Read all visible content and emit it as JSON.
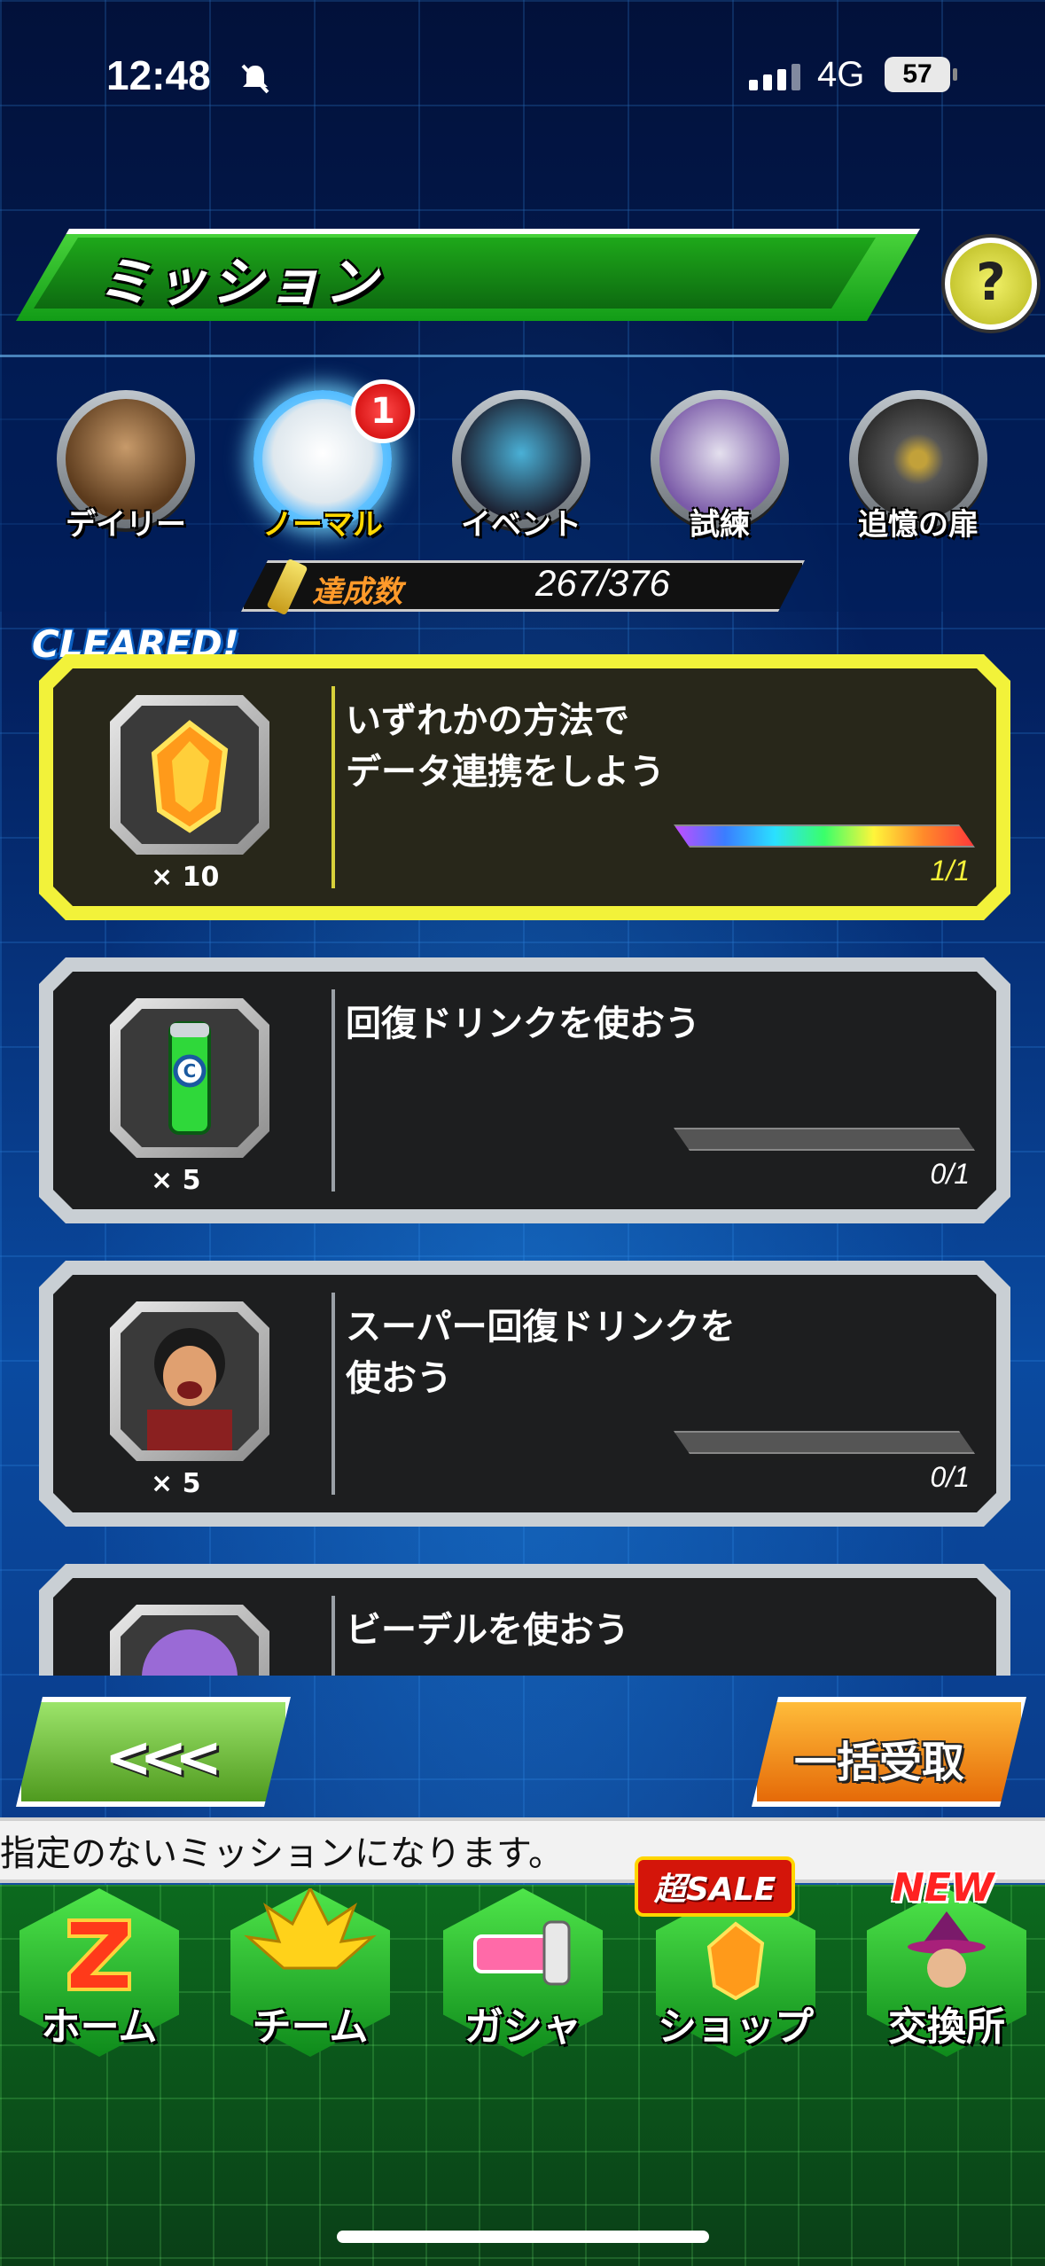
{
  "status_bar": {
    "time": "12:48",
    "network": "4G",
    "battery": "57"
  },
  "header": {
    "title": "ミッション",
    "help_label": "?"
  },
  "tabs": [
    {
      "label": "デイリー",
      "active": false
    },
    {
      "label": "ノーマル",
      "active": true,
      "badge": "1"
    },
    {
      "label": "イベント",
      "active": false
    },
    {
      "label": "試練",
      "active": false
    },
    {
      "label": "追憶の扉",
      "active": false
    }
  ],
  "progress": {
    "label": "達成数",
    "value": "267/376"
  },
  "cleared_tag": "CLEARED!",
  "missions": [
    {
      "text": "いずれかの方法で\nデータ連携をしよう",
      "reward_qty": "× 10",
      "reward": "dragon-stone-icon",
      "count": "1/1",
      "progress": 1.0,
      "cleared": true
    },
    {
      "text": "回復ドリンクを使おう",
      "reward_qty": "× 5",
      "reward": "recovery-drink-icon",
      "count": "0/1",
      "progress": 0.0,
      "cleared": false
    },
    {
      "text": "スーパー回復ドリンクを\n使おう",
      "reward_qty": "× 5",
      "reward": "character-portrait-icon",
      "count": "0/1",
      "progress": 0.0,
      "cleared": false
    },
    {
      "text": "ビーデルを使おう",
      "reward_qty": "",
      "reward": "character-portrait-icon",
      "count": "",
      "progress": 0.0,
      "cleared": false
    }
  ],
  "buttons": {
    "back": "<<<",
    "claim_all": "一括受取"
  },
  "marquee": "指定のないミッションになります。",
  "nav": [
    {
      "label": "ホーム",
      "icon": "home-z-icon"
    },
    {
      "label": "チーム",
      "icon": "team-icon"
    },
    {
      "label": "ガシャ",
      "icon": "gacha-icon"
    },
    {
      "label": "ショップ",
      "icon": "shop-icon",
      "tag": "超SALE"
    },
    {
      "label": "交換所",
      "icon": "exchange-icon",
      "tag": "NEW"
    }
  ],
  "colors": {
    "accent_green": "#129c17",
    "cleared_yellow": "#f2f23a",
    "badge_red": "#d10000"
  }
}
